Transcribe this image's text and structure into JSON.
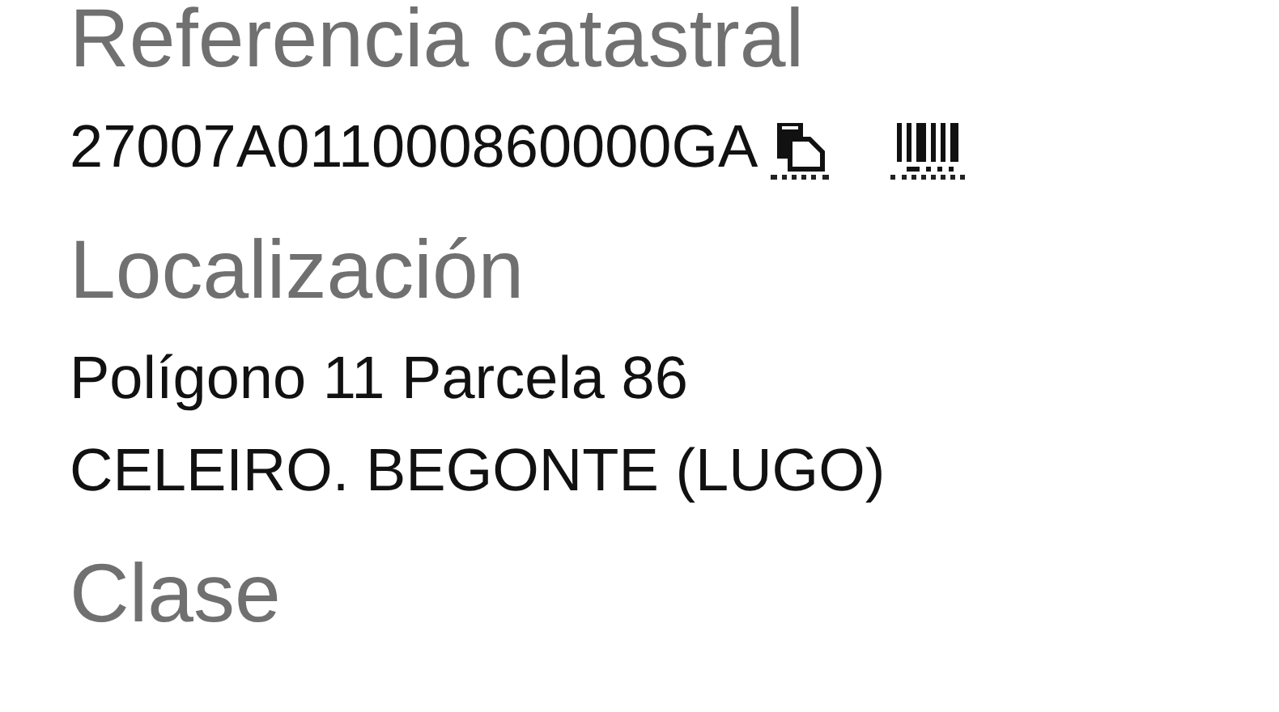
{
  "sections": [
    {
      "heading": "Referencia catastral",
      "lines": [
        "27007A011000860000GA"
      ],
      "actions": [
        {
          "kind": "copy"
        },
        {
          "kind": "barcode"
        }
      ]
    },
    {
      "heading": "Localización",
      "lines": [
        "Polígono 11 Parcela 86",
        "CELEIRO. BEGONTE (LUGO)"
      ]
    },
    {
      "heading": "Clase"
    }
  ]
}
